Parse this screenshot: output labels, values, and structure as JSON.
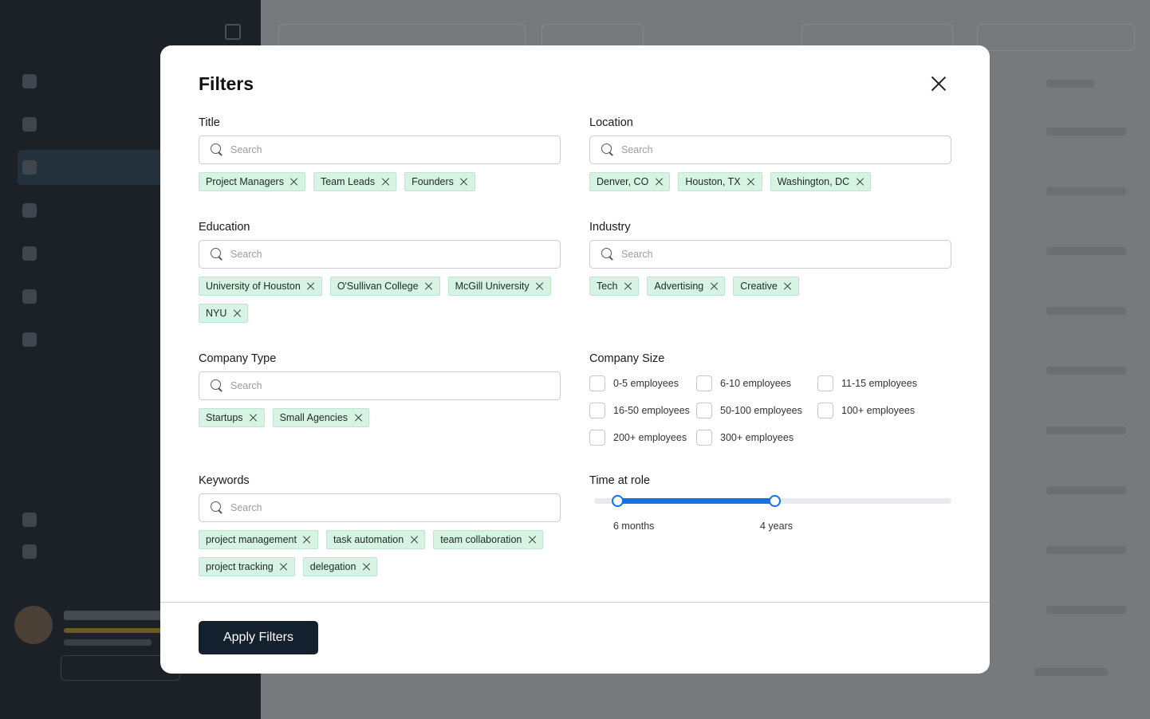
{
  "modal": {
    "title": "Filters",
    "apply_label": "Apply Filters",
    "title_section": {
      "label": "Title",
      "placeholder": "Search",
      "chips": [
        "Project Managers",
        "Team Leads",
        "Founders"
      ]
    },
    "location_section": {
      "label": "Location",
      "placeholder": "Search",
      "chips": [
        "Denver, CO",
        "Houston, TX",
        "Washington, DC"
      ]
    },
    "education_section": {
      "label": "Education",
      "placeholder": "Search",
      "chips": [
        "University of Houston",
        "O'Sullivan College",
        "McGill University",
        "NYU"
      ]
    },
    "industry_section": {
      "label": "Industry",
      "placeholder": "Search",
      "chips": [
        "Tech",
        "Advertising",
        "Creative"
      ]
    },
    "company_type_section": {
      "label": "Company Type",
      "placeholder": "Search",
      "chips": [
        "Startups",
        "Small Agencies"
      ]
    },
    "company_size_section": {
      "label": "Company Size",
      "options": [
        "0-5 employees",
        "6-10 employees",
        "11-15 employees",
        "16-50 employees",
        "50-100 employees",
        "100+ employees",
        "200+ employees",
        "300+ employees"
      ]
    },
    "keywords_section": {
      "label": "Keywords",
      "placeholder": "Search",
      "chips": [
        "project management",
        "task automation",
        "team collaboration",
        "project tracking",
        "delegation"
      ]
    },
    "time_at_role_section": {
      "label": "Time at role",
      "min_label": "6 months",
      "max_label": "4 years",
      "range_fraction": [
        0.065,
        0.505
      ]
    }
  },
  "colors": {
    "accent": "#1473e6",
    "chip_bg": "#d7f3e3",
    "apply_bg": "#13202e"
  }
}
